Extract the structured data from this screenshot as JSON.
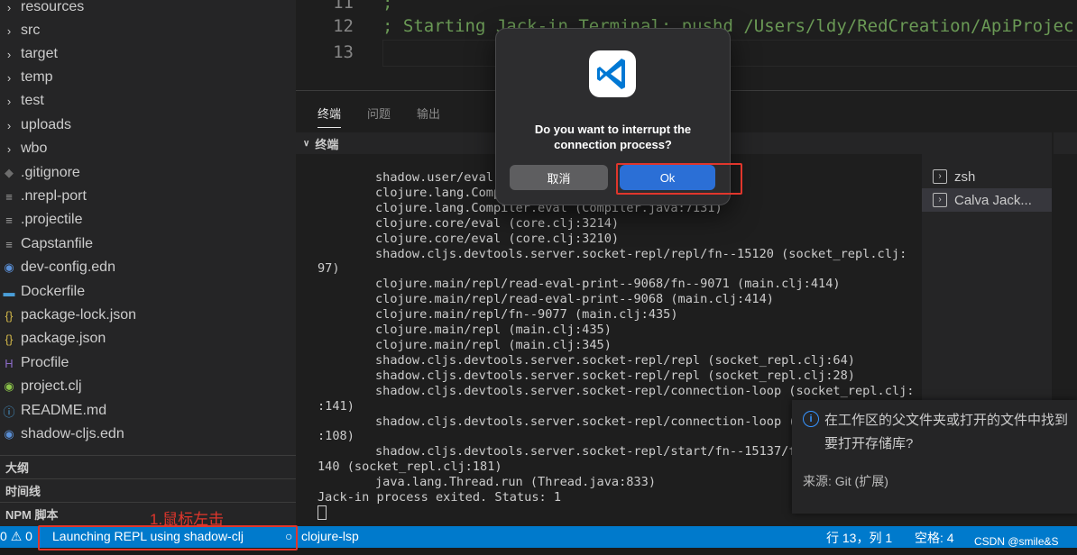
{
  "sidebar": {
    "items": [
      {
        "label": "resources",
        "icon": "chevron-right-icon"
      },
      {
        "label": "src",
        "icon": "chevron-right-icon"
      },
      {
        "label": "target",
        "icon": "chevron-right-icon"
      },
      {
        "label": "temp",
        "icon": "chevron-right-icon"
      },
      {
        "label": "test",
        "icon": "chevron-right-icon"
      },
      {
        "label": "uploads",
        "icon": "chevron-right-icon"
      },
      {
        "label": "wbo",
        "icon": "chevron-right-icon"
      },
      {
        "label": ".gitignore",
        "icon": "git-file-icon"
      },
      {
        "label": ".nrepl-port",
        "icon": "text-file-icon"
      },
      {
        "label": ".projectile",
        "icon": "text-file-icon"
      },
      {
        "label": "Capstanfile",
        "icon": "text-file-icon"
      },
      {
        "label": "dev-config.edn",
        "icon": "clojure-icon"
      },
      {
        "label": "Dockerfile",
        "icon": "docker-icon"
      },
      {
        "label": "package-lock.json",
        "icon": "json-icon"
      },
      {
        "label": "package.json",
        "icon": "json-icon"
      },
      {
        "label": "Procfile",
        "icon": "heroku-icon"
      },
      {
        "label": "project.clj",
        "icon": "clojure-icon"
      },
      {
        "label": "README.md",
        "icon": "info-icon"
      },
      {
        "label": "shadow-cljs.edn",
        "icon": "clojure-icon"
      }
    ],
    "sections": [
      "大纲",
      "时间线",
      "NPM 脚本"
    ]
  },
  "editor": {
    "lines": [
      {
        "num": "11",
        "text": ";"
      },
      {
        "num": "12",
        "text": "; Starting Jack-in Terminal: pushd /Users/ldy/RedCreation/ApiProjec"
      },
      {
        "num": "13",
        "text": ""
      }
    ]
  },
  "panel": {
    "tabs": [
      "终端",
      "问题",
      "输出"
    ],
    "terminal_title": "终端",
    "terminal_lines": [
      {
        "indent": true,
        "text": "shadow.user/eval"
      },
      {
        "indent": true,
        "text": "clojure.lang.Compi"
      },
      {
        "indent": true,
        "text": "clojure.lang.Compiler.eval (Compiler.java:7131)"
      },
      {
        "indent": true,
        "text": "clojure.core/eval (core.clj:3214)"
      },
      {
        "indent": true,
        "text": "clojure.core/eval (core.clj:3210)"
      },
      {
        "indent": true,
        "text": "shadow.cljs.devtools.server.socket-repl/repl/fn--15120 (socket_repl.clj:"
      },
      {
        "indent": false,
        "text": "97)"
      },
      {
        "indent": true,
        "text": "clojure.main/repl/read-eval-print--9068/fn--9071 (main.clj:414)"
      },
      {
        "indent": true,
        "text": "clojure.main/repl/read-eval-print--9068 (main.clj:414)"
      },
      {
        "indent": true,
        "text": "clojure.main/repl/fn--9077 (main.clj:435)"
      },
      {
        "indent": true,
        "text": "clojure.main/repl (main.clj:435)"
      },
      {
        "indent": true,
        "text": "clojure.main/repl (main.clj:345)"
      },
      {
        "indent": true,
        "text": "shadow.cljs.devtools.server.socket-repl/repl (socket_repl.clj:64)"
      },
      {
        "indent": true,
        "text": "shadow.cljs.devtools.server.socket-repl/repl (socket_repl.clj:28)"
      },
      {
        "indent": true,
        "text": "shadow.cljs.devtools.server.socket-repl/connection-loop (socket_repl.clj:"
      },
      {
        "indent": false,
        "text": ":141)"
      },
      {
        "indent": true,
        "text": "shadow.cljs.devtools.server.socket-repl/connection-loop (s"
      },
      {
        "indent": false,
        "text": ":108)"
      },
      {
        "indent": true,
        "text": "shadow.cljs.devtools.server.socket-repl/start/fn--15137/fr"
      },
      {
        "indent": false,
        "text": "140 (socket_repl.clj:181)"
      },
      {
        "indent": true,
        "text": "java.lang.Thread.run (Thread.java:833)"
      },
      {
        "indent": false,
        "text": "Jack-in process exited. Status: 1"
      }
    ],
    "terminal_list": [
      "zsh",
      "Calva Jack..."
    ]
  },
  "dialog": {
    "message": "Do you want to interrupt the connection process?",
    "cancel_label": "取消",
    "ok_label": "Ok"
  },
  "notification": {
    "message": "在工作区的父文件夹或打开的文件中找到要打开存储库?",
    "source": "来源: Git (扩展)"
  },
  "statusbar": {
    "errors": "0",
    "warnings": "0",
    "repl_status": "Launching REPL using shadow-clj",
    "lsp": "clojure-lsp",
    "position": "行 13，列 1",
    "spaces": "空格: 4"
  },
  "annotation": {
    "text": "1.鼠标左击"
  },
  "watermark": "CSDN @smile&S",
  "colors": {
    "status_bar": "#007acc",
    "annotation_red": "#e0362c",
    "ok_button": "#2b6fd6"
  }
}
